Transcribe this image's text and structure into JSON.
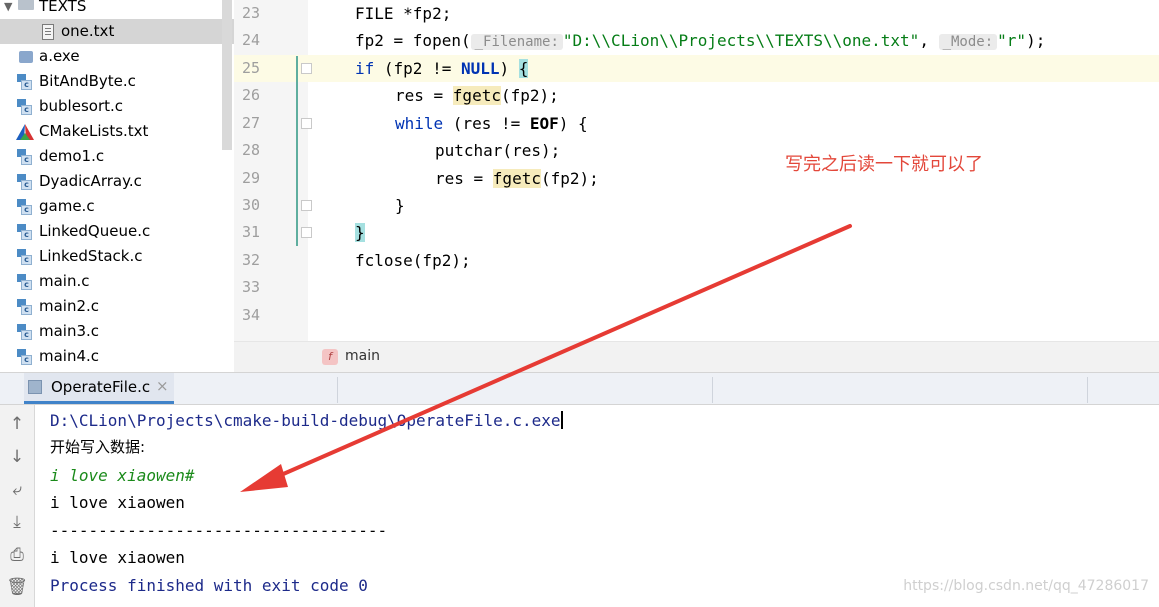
{
  "tree": {
    "items": [
      {
        "label": "TEXTS",
        "icon": "folder-icon"
      },
      {
        "label": "one.txt",
        "icon": "text-file-icon",
        "selected": true
      },
      {
        "label": "a.exe",
        "icon": "exe-file-icon"
      },
      {
        "label": "BitAndByte.c",
        "icon": "c-file-icon"
      },
      {
        "label": "bublesort.c",
        "icon": "c-file-icon"
      },
      {
        "label": "CMakeLists.txt",
        "icon": "cmake-icon"
      },
      {
        "label": "demo1.c",
        "icon": "c-file-icon"
      },
      {
        "label": "DyadicArray.c",
        "icon": "c-file-icon"
      },
      {
        "label": "game.c",
        "icon": "c-file-icon"
      },
      {
        "label": "LinkedQueue.c",
        "icon": "c-file-icon"
      },
      {
        "label": "LinkedStack.c",
        "icon": "c-file-icon"
      },
      {
        "label": "main.c",
        "icon": "c-file-icon"
      },
      {
        "label": "main2.c",
        "icon": "c-file-icon"
      },
      {
        "label": "main3.c",
        "icon": "c-file-icon"
      },
      {
        "label": "main4.c",
        "icon": "c-file-icon"
      }
    ]
  },
  "editor": {
    "line_numbers": [
      "23",
      "24",
      "25",
      "26",
      "27",
      "28",
      "29",
      "30",
      "31",
      "32",
      "33",
      "34"
    ],
    "lines": {
      "l23": {
        "a": "FILE *fp2;"
      },
      "l24": {
        "a": "fp2 = fopen(",
        "hint1": "_Filename:",
        "str1": "\"D:\\\\CLion\\\\Projects\\\\TEXTS\\\\one.txt\"",
        "b": ", ",
        "hint2": "_Mode:",
        "str2": "\"r\"",
        "c": ");"
      },
      "l25": {
        "kw": "if",
        "a": " (fp2 != ",
        "kw2": "NULL",
        "b": ") ",
        "brace": "{"
      },
      "l26": {
        "a": "res = ",
        "fn": "fgetc",
        "b": "(fp2);"
      },
      "l27": {
        "kw": "while",
        "a": " (res != ",
        "kw2": "EOF",
        "b": ") {"
      },
      "l28": {
        "a": "putchar(res);"
      },
      "l29": {
        "a": "res = ",
        "fn": "fgetc",
        "b": "(fp2);"
      },
      "l30": {
        "a": "}"
      },
      "l31": {
        "brace": "}"
      },
      "l32": {
        "a": "fclose(fp2);"
      }
    },
    "annotation": "写完之后读一下就可以了",
    "annotation_color": "#e3473a"
  },
  "breadcrumb": {
    "badge": "f",
    "label": "main"
  },
  "run_tab": {
    "label": "OperateFile.c",
    "close": "×"
  },
  "console": {
    "path": "D:\\CLion\\Projects\\cmake-build-debug\\OperateFile.c.exe",
    "prompt": "开始写入数据:",
    "input": "i love xiaowen#",
    "out1": "i love xiaowen",
    "divider": "-----------------------------------",
    "out2": "i love xiaowen",
    "finished": "Process finished with exit code 0"
  },
  "watermark": "https://blog.csdn.net/qq_47286017",
  "toolbar_icons": [
    "up-arrow-icon",
    "down-arrow-icon",
    "soft-wrap-icon",
    "scroll-to-end-icon",
    "print-icon",
    "trash-icon"
  ]
}
